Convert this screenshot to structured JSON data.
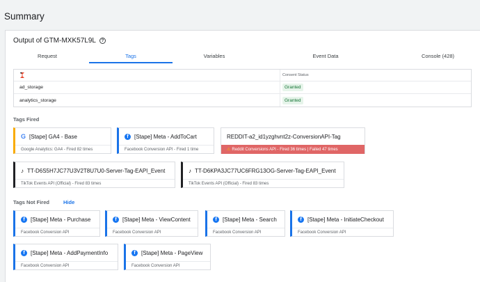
{
  "page": {
    "title": "Summary"
  },
  "output": {
    "title": "Output of GTM-MXK57L9L"
  },
  "tabs": [
    {
      "label": "Request",
      "active": false
    },
    {
      "label": "Tags",
      "active": true
    },
    {
      "label": "Variables",
      "active": false
    },
    {
      "label": "Event Data",
      "active": false
    },
    {
      "label": "Console (428)",
      "active": false
    }
  ],
  "consent": {
    "header": "Consent Status",
    "rows": [
      {
        "name": "ad_storage",
        "status": "Granted"
      },
      {
        "name": "analytics_storage",
        "status": "Granted"
      }
    ]
  },
  "tags_fired": {
    "label": "Tags Fired",
    "cards": [
      {
        "name": "[Stape] GA4 - Base",
        "subtitle": "Google Analytics: GA4 - Fired 82 times",
        "icon": "google-icon"
      },
      {
        "name": "[Stape] Meta - AddToCart",
        "subtitle": "Facebook Conversion API - Fired 1 time",
        "icon": "facebook-icon"
      },
      {
        "name": "REDDIT-a2_id1yzghvnt2z-ConversionAPI-Tag",
        "subtitle": "Reddit Conversions API - Fired 36 times | Failed 47 times",
        "icon": "warning-icon"
      },
      {
        "name": "TT-D6S5H7JC77U3V2T8U7U0-Server-Tag-EAPI_Event",
        "subtitle": "TikTok Events API (Official) - Fired 83 times",
        "icon": "tiktok-icon"
      },
      {
        "name": "TT-D6KPA3JC77UC6FRG13OG-Server-Tag-EAPI_Event",
        "subtitle": "TikTok Events API (Official) - Fired 83 times",
        "icon": "tiktok-icon"
      }
    ]
  },
  "tags_not_fired": {
    "label": "Tags Not Fired",
    "hide_label": "Hide",
    "cards": [
      {
        "name": "[Stape] Meta - Purchase",
        "subtitle": "Facebook Conversion API"
      },
      {
        "name": "[Stape] Meta - ViewContent",
        "subtitle": "Facebook Conversion API"
      },
      {
        "name": "[Stape] Meta - Search",
        "subtitle": "Facebook Conversion API"
      },
      {
        "name": "[Stape] Meta - InitiateCheckout",
        "subtitle": "Facebook Conversion API"
      },
      {
        "name": "[Stape] Meta - AddPaymentInfo",
        "subtitle": "Facebook Conversion API"
      },
      {
        "name": "[Stape] Meta - PageView",
        "subtitle": "Facebook Conversion API"
      }
    ]
  },
  "colors": {
    "accent": "#1a73e8",
    "granted_bg": "#e6f4ea",
    "error_bg": "#e06666",
    "facebook": "#1877f2"
  }
}
